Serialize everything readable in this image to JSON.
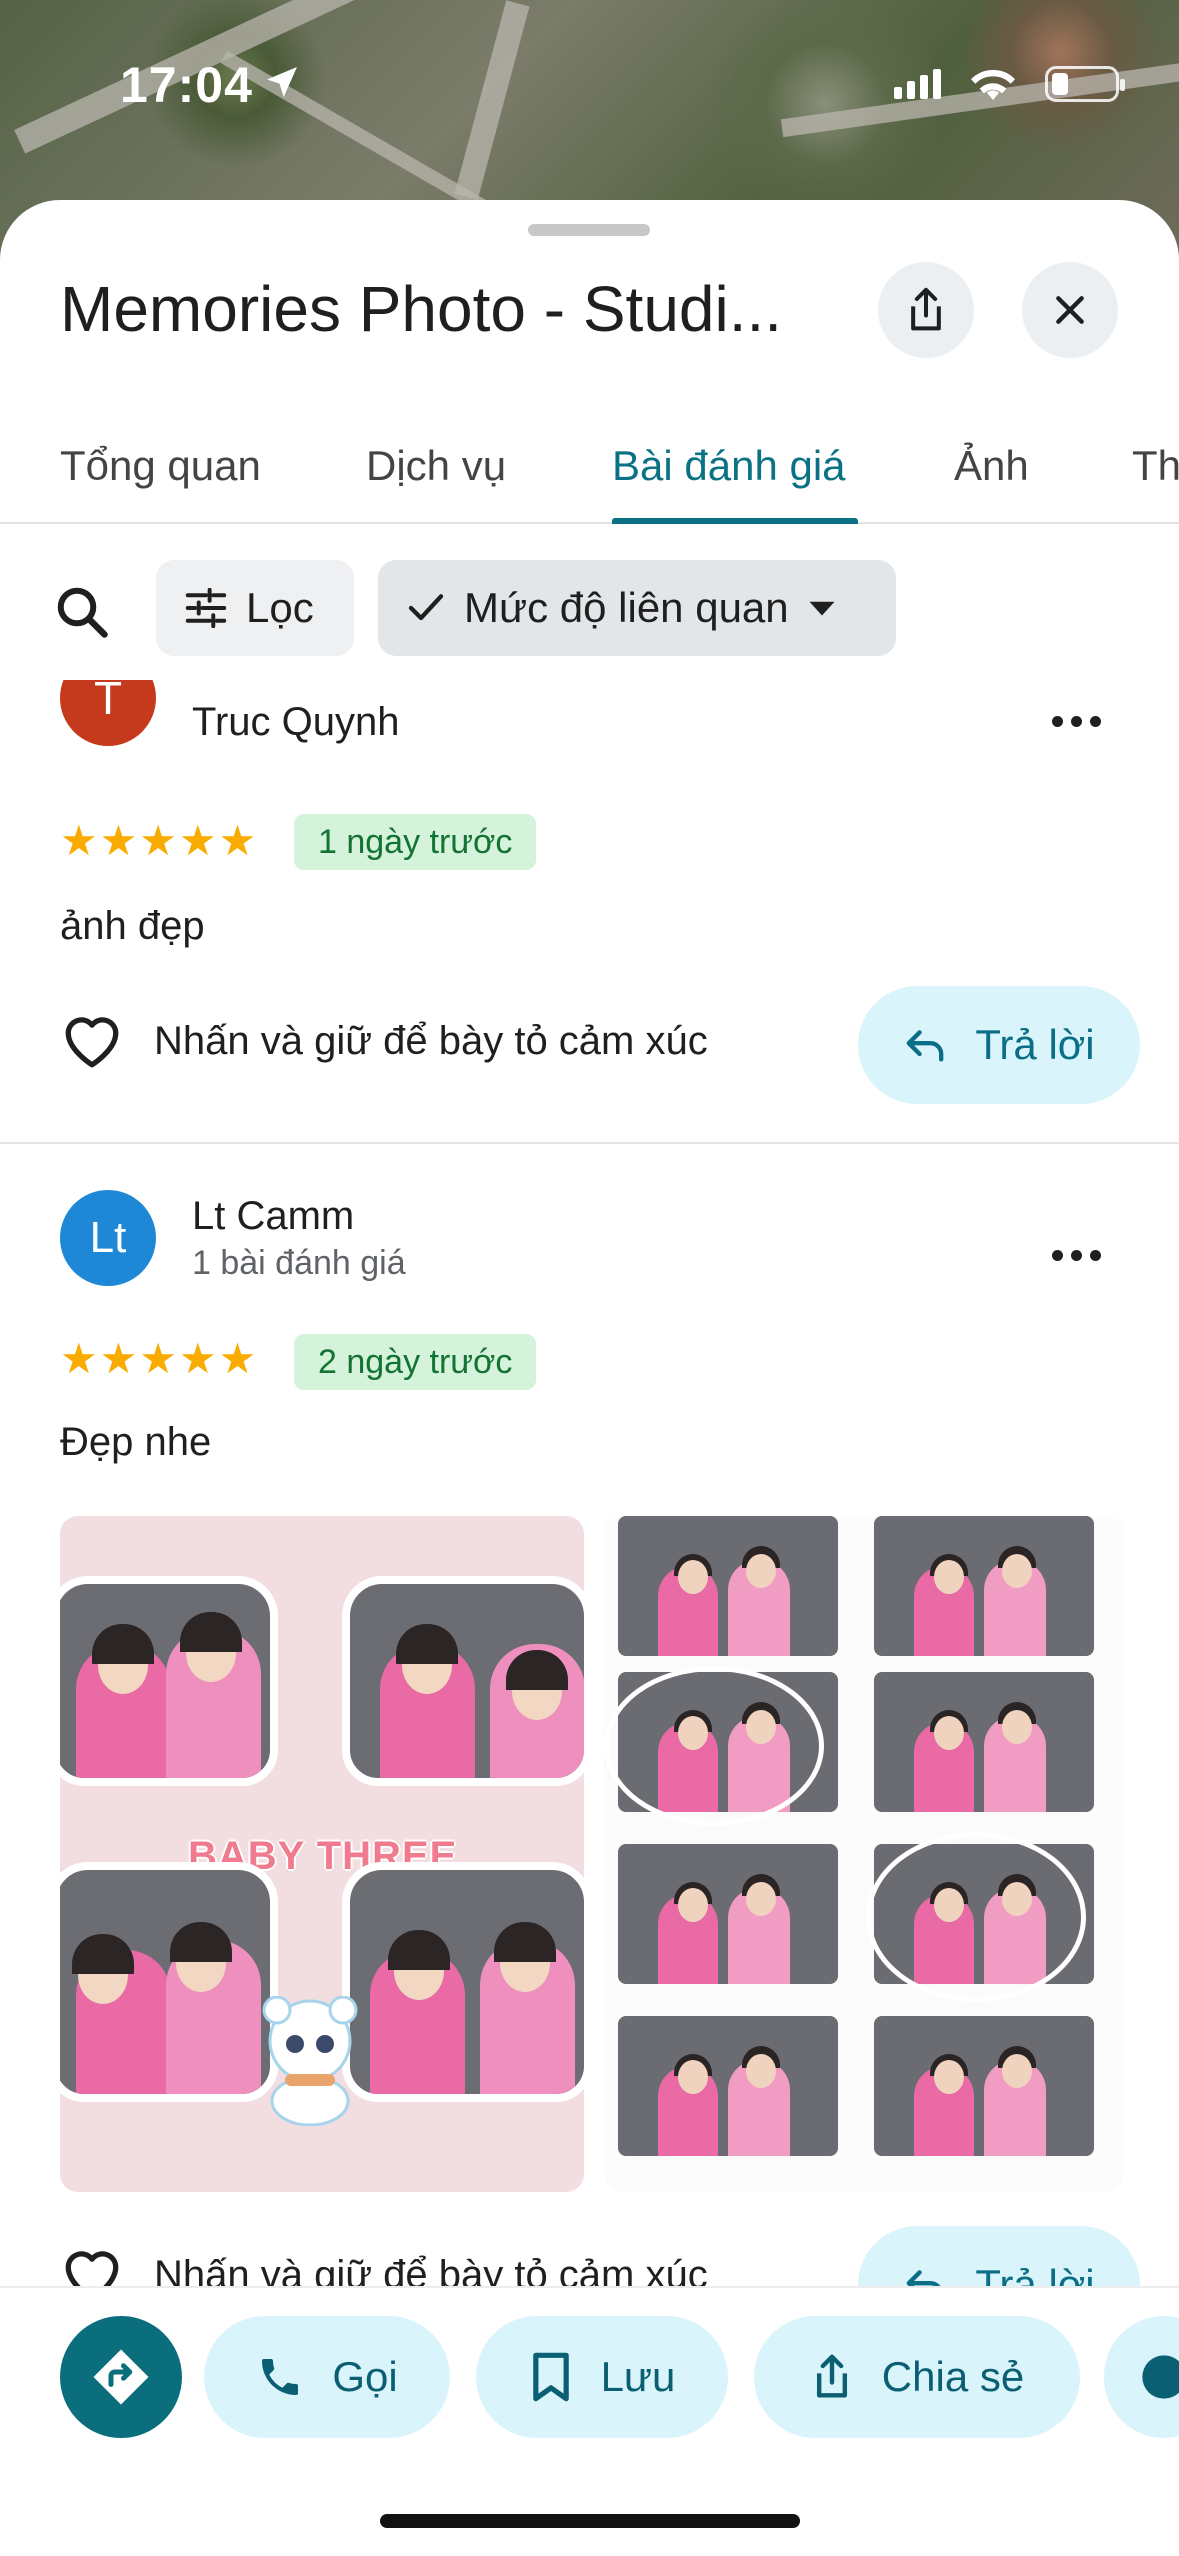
{
  "status": {
    "time": "17:04"
  },
  "place": {
    "title": "Memories Photo - Studi..."
  },
  "tabs": [
    {
      "label": "Tổng quan"
    },
    {
      "label": "Dịch vụ"
    },
    {
      "label": "Bài đánh giá"
    },
    {
      "label": "Ảnh"
    },
    {
      "label": "Th"
    }
  ],
  "filters": {
    "filter_label": "Lọc",
    "sort_label": "Mức độ liên quan"
  },
  "reviews": [
    {
      "avatar_letter": "T",
      "avatar_color": "#c5391d",
      "name": "Truc Quynh",
      "stars": "★★★★★",
      "date": "1 ngày trước",
      "text": "ảnh đẹp",
      "react_label": "Nhấn và giữ để bày tỏ cảm xúc",
      "reply_label": "Trả lời"
    },
    {
      "avatar_letter": "Lt",
      "avatar_color": "#1e88d6",
      "name": "Lt Camm",
      "subtitle": "1 bài đánh giá",
      "stars": "★★★★★",
      "date": "2 ngày trước",
      "text": "Đẹp nhe",
      "photo_caption": "BABY THREE",
      "react_label": "Nhấn và giữ để bày tỏ cảm xúc",
      "reply_label": "Trả lời"
    }
  ],
  "actions": [
    {
      "label": "Gọi",
      "icon": "phone-icon"
    },
    {
      "label": "Lưu",
      "icon": "bookmark-icon"
    },
    {
      "label": "Chia sẻ",
      "icon": "share-icon"
    }
  ],
  "colors": {
    "accent": "#0b7285",
    "star": "#f9ab00",
    "badge_bg": "#d5f2db",
    "button_bg": "#daf4fb"
  }
}
